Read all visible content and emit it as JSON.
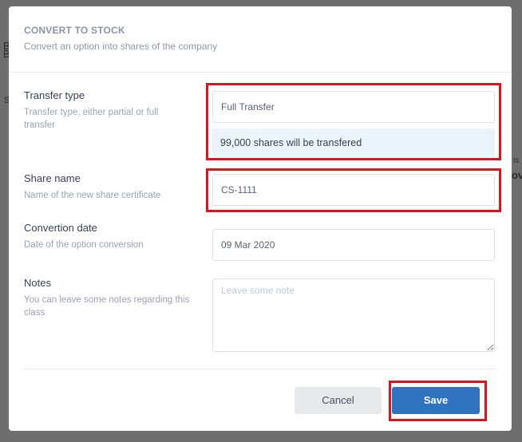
{
  "modal": {
    "title": "CONVERT TO STOCK",
    "subtitle": "Convert an option into shares of the company"
  },
  "fields": {
    "transfer_type": {
      "label": "Transfer type",
      "hint": "Transfer type, either partial or full transfer",
      "value": "Full Transfer",
      "info": "99,000 shares will be transfered"
    },
    "share_name": {
      "label": "Share name",
      "hint": "Name of the new share certificate",
      "value": "CS-1111"
    },
    "conversion_date": {
      "label": "Convertion date",
      "hint": "Date of the option conversion",
      "value": "09 Mar 2020"
    },
    "notes": {
      "label": "Notes",
      "hint": "You can leave some notes regarding this class",
      "placeholder": "Leave some note",
      "value": ""
    }
  },
  "actions": {
    "cancel_label": "Cancel",
    "save_label": "Save"
  },
  "background": {
    "frag_1": "B",
    "frag_2": "B",
    "frag_3": "S",
    "frag_4": "is",
    "frag_5": "ov"
  },
  "colors": {
    "primary": "#2f73bf",
    "highlight": "#e0121b",
    "info_bg": "#eaf4fa"
  }
}
